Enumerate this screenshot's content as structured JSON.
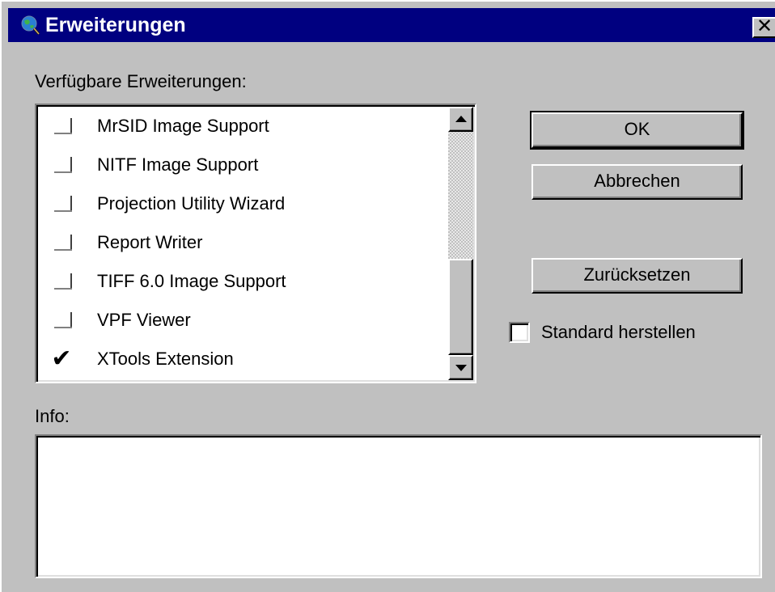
{
  "window": {
    "title": "Erweiterungen",
    "close_label": "✕"
  },
  "extensions_label": "Verfügbare Erweiterungen:",
  "extensions": [
    {
      "label": "MrSID Image Support",
      "checked": false
    },
    {
      "label": "NITF Image Support",
      "checked": false
    },
    {
      "label": "Projection Utility Wizard",
      "checked": false
    },
    {
      "label": "Report Writer",
      "checked": false
    },
    {
      "label": "TIFF 6.0 Image Support",
      "checked": false
    },
    {
      "label": "VPF Viewer",
      "checked": false
    },
    {
      "label": "XTools Extension",
      "checked": true
    }
  ],
  "check_mark": "✔",
  "buttons": {
    "ok": "OK",
    "cancel": "Abbrechen",
    "reset": "Zurücksetzen"
  },
  "default_checkbox": {
    "label": "Standard herstellen",
    "checked": false
  },
  "info_label": "Info:",
  "info_text": "",
  "colors": {
    "titlebar": "#000080",
    "face": "#c0c0c0"
  }
}
